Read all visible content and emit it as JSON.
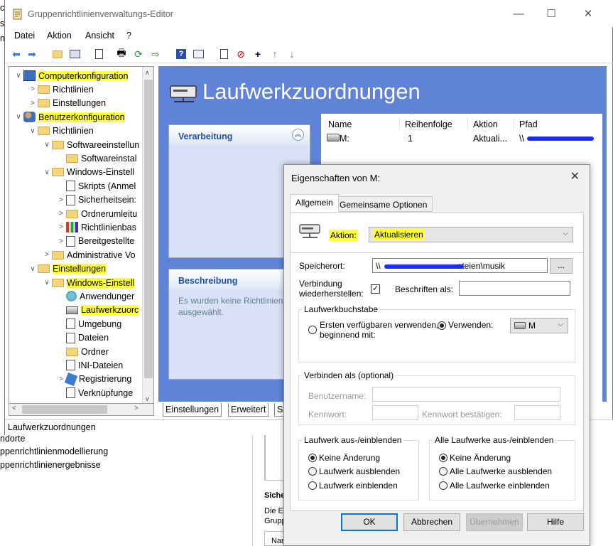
{
  "background": {
    "left_fragments": [
      "ch",
      "st",
      "na",
      "",
      "",
      "",
      "",
      "",
      "",
      "",
      ""
    ],
    "left_lines": [
      "ndorte",
      "ppenrichtlinienmodellierung",
      "ppenrichtlinienergebnisse"
    ],
    "right_panel_title": "Siche",
    "right_panel_line1": "Die E",
    "right_panel_line2": "Grupp",
    "right_panel_col": "Name"
  },
  "window": {
    "title": "Gruppenrichtlinienverwaltungs-Editor",
    "minimize": "—",
    "maximize": "☐",
    "close": "✕"
  },
  "menu": [
    "Datei",
    "Aktion",
    "Ansicht",
    "?"
  ],
  "tree": [
    {
      "label": "Computerkonfiguration",
      "level": 0,
      "exp": "∨",
      "icon": "computer-icon",
      "highlight": true
    },
    {
      "label": "Richtlinien",
      "level": 1,
      "exp": ">",
      "icon": "folder-icon",
      "highlight": false
    },
    {
      "label": "Einstellungen",
      "level": 1,
      "exp": ">",
      "icon": "folder-icon",
      "highlight": false
    },
    {
      "label": "Benutzerkonfiguration",
      "level": 0,
      "exp": "∨",
      "icon": "users-icon",
      "highlight": true
    },
    {
      "label": "Richtlinien",
      "level": 1,
      "exp": "∨",
      "icon": "folder-icon",
      "highlight": false
    },
    {
      "label": "Softwareeinstellun",
      "level": 2,
      "exp": "∨",
      "icon": "folder-icon",
      "highlight": false
    },
    {
      "label": "Softwareinstal",
      "level": 3,
      "exp": "",
      "icon": "folder-icon",
      "highlight": false
    },
    {
      "label": "Windows-Einstell",
      "level": 2,
      "exp": "∨",
      "icon": "folder-icon",
      "highlight": false
    },
    {
      "label": "Skripts (Anmel",
      "level": 3,
      "exp": "",
      "icon": "script-icon",
      "highlight": false
    },
    {
      "label": "Sicherheitsein:",
      "level": 3,
      "exp": ">",
      "icon": "security-icon",
      "highlight": false
    },
    {
      "label": "Ordnerumleitu",
      "level": 3,
      "exp": ">",
      "icon": "folder-icon",
      "highlight": false
    },
    {
      "label": "Richtlinienbas",
      "level": 3,
      "exp": ">",
      "icon": "chart-icon",
      "highlight": false
    },
    {
      "label": "Bereitgestellte",
      "level": 3,
      "exp": ">",
      "icon": "printer-icon",
      "highlight": false
    },
    {
      "label": "Administrative Vo",
      "level": 2,
      "exp": ">",
      "icon": "folder-icon",
      "highlight": false
    },
    {
      "label": "Einstellungen",
      "level": 1,
      "exp": "∨",
      "icon": "folder-icon",
      "highlight": true
    },
    {
      "label": "Windows-Einstell",
      "level": 2,
      "exp": "∨",
      "icon": "folder-icon",
      "highlight": true
    },
    {
      "label": "Anwendunger",
      "level": 3,
      "exp": "",
      "icon": "globe-icon",
      "highlight": false
    },
    {
      "label": "Laufwerkzuorc",
      "level": 3,
      "exp": "",
      "icon": "drive-icon",
      "highlight": true
    },
    {
      "label": "Umgebung",
      "level": 3,
      "exp": "",
      "icon": "env-icon",
      "highlight": false
    },
    {
      "label": "Dateien",
      "level": 3,
      "exp": "",
      "icon": "file-icon",
      "highlight": false
    },
    {
      "label": "Ordner",
      "level": 3,
      "exp": "",
      "icon": "folder-icon",
      "highlight": false
    },
    {
      "label": "INI-Dateien",
      "level": 3,
      "exp": "",
      "icon": "ini-icon",
      "highlight": false
    },
    {
      "label": "Registrierung",
      "level": 3,
      "exp": ">",
      "icon": "registry-icon",
      "highlight": false
    },
    {
      "label": "Verknüpfunge",
      "level": 3,
      "exp": "",
      "icon": "shortcut-icon",
      "highlight": false
    }
  ],
  "status": "Laufwerkzuordnungen",
  "pane": {
    "title": "Laufwerkzuordnungen",
    "processing": "Verarbeitung",
    "description_title": "Beschreibung",
    "description_text": "Es wurden keine Richtlinien ausgewählt.",
    "columns": [
      "Name",
      "Reihenfolge",
      "Aktion",
      "Pfad"
    ],
    "row": {
      "name": "M:",
      "order": "1",
      "action": "Aktuali...",
      "path": "\\\\"
    },
    "bottom_tabs": [
      "Einstellungen",
      "Erweitert",
      "Sta"
    ]
  },
  "dialog": {
    "title": "Eigenschaften von M:",
    "close": "✕",
    "tabs": [
      "Allgemein",
      "Gemeinsame Optionen"
    ],
    "action_label": "Aktion:",
    "action_value": "Aktualisieren",
    "location_label": "Speicherort:",
    "location_value_prefix": "\\\\",
    "location_value_suffix": "ateien\\musik",
    "browse": "...",
    "reconnect_label": "Verbindung wiederherstellen:",
    "reconnect_label_1": "Verbindung",
    "reconnect_label_2": "wiederherstellen:",
    "reconnect_checked": "✓",
    "labels_label": "Beschriften als:",
    "labels_value": "",
    "drive_letter_group": "Laufwerkbuchstabe",
    "first_available": "Ersten verfügbaren verwenden,",
    "first_available_2": "beginnend mit:",
    "use_label": "Verwenden:",
    "drive_letter": "M",
    "connect_as_group": "Verbinden als (optional)",
    "username_label": "Benutzername:",
    "password_label": "Kennwort:",
    "confirm_password_label": "Kennwort bestätigen:",
    "hide_show_drive_group": "Laufwerk aus-/einblenden",
    "hide_show_drive_options": [
      "Keine Änderung",
      "Laufwerk ausblenden",
      "Laufwerk einblenden"
    ],
    "hide_show_all_group": "Alle Laufwerke aus-/einblenden",
    "hide_show_all_options": [
      "Keine Änderung",
      "Alle Laufwerke ausblenden",
      "Alle Laufwerke einblenden"
    ],
    "buttons": {
      "ok": "OK",
      "cancel": "Abbrechen",
      "apply": "Übernehmen",
      "help": "Hilfe"
    }
  },
  "colors": {
    "highlight": "#ffff33",
    "pane_blue": "#5f83d6",
    "link_blue": "#1f4fa8",
    "accent": "#0078d7"
  }
}
